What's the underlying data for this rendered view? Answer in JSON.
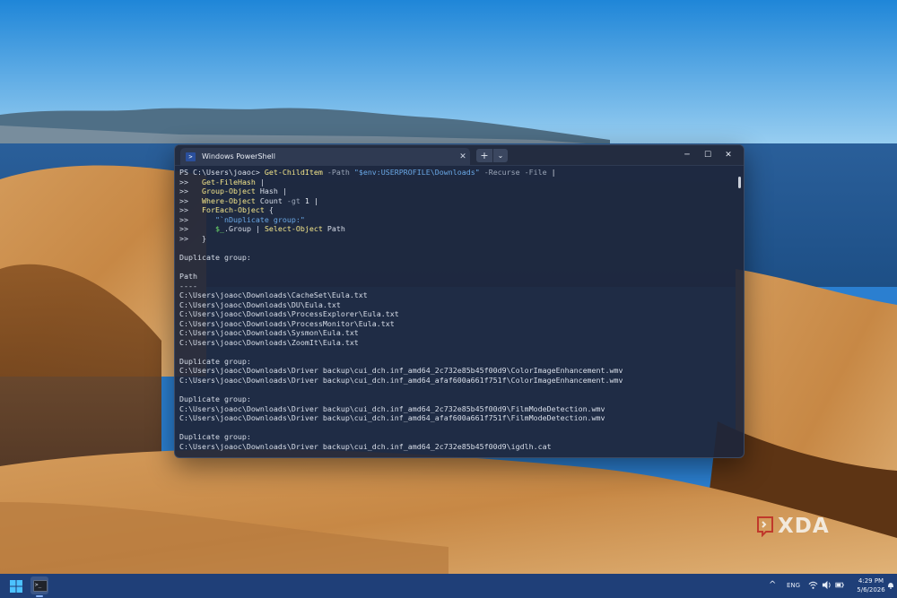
{
  "terminal": {
    "tab_title": "Windows PowerShell",
    "close_tab_glyph": "✕",
    "new_tab_glyph": "+",
    "dropdown_glyph": "⌄",
    "window_minimize": "─",
    "window_maximize": "☐",
    "window_close": "✕",
    "tab_icon": "powershell-icon",
    "lines": [
      [
        {
          "t": "PS C:\\Users\\joaoc> "
        },
        {
          "t": "Get-ChildItem",
          "c": "c-cmd"
        },
        {
          "t": " -Path ",
          "c": "c-param"
        },
        {
          "t": "\"$env:USERPROFILE",
          "c": "c-str2"
        },
        {
          "t": "\\Downloads\"",
          "c": "c-str2"
        },
        {
          "t": " -Recurse -File ",
          "c": "c-param"
        },
        {
          "t": "|"
        }
      ],
      [
        {
          "t": ">>   "
        },
        {
          "t": "Get-FileHash",
          "c": "c-cmd"
        },
        {
          "t": " |"
        }
      ],
      [
        {
          "t": ">>   "
        },
        {
          "t": "Group-Object",
          "c": "c-cmd"
        },
        {
          "t": " Hash |"
        }
      ],
      [
        {
          "t": ">>   "
        },
        {
          "t": "Where-Object",
          "c": "c-cmd"
        },
        {
          "t": " Count "
        },
        {
          "t": "-gt",
          "c": "c-param"
        },
        {
          "t": " 1 |",
          "c": "c-white"
        }
      ],
      [
        {
          "t": ">>   "
        },
        {
          "t": "ForEach-Object",
          "c": "c-cmd"
        },
        {
          "t": " {"
        }
      ],
      [
        {
          "t": ">>      "
        },
        {
          "t": "\"`nDuplicate group:\"",
          "c": "c-str2"
        }
      ],
      [
        {
          "t": ">>      "
        },
        {
          "t": "$_",
          "c": "c-var"
        },
        {
          "t": ".Group | "
        },
        {
          "t": "Select-Object",
          "c": "c-cmd"
        },
        {
          "t": " Path"
        }
      ],
      [
        {
          "t": ">>   }"
        }
      ],
      [
        {
          "t": ""
        }
      ],
      [
        {
          "t": "Duplicate group:"
        }
      ],
      [
        {
          "t": ""
        }
      ],
      [
        {
          "t": "Path"
        }
      ],
      [
        {
          "t": "----"
        }
      ],
      [
        {
          "t": "C:\\Users\\joaoc\\Downloads\\CacheSet\\Eula.txt"
        }
      ],
      [
        {
          "t": "C:\\Users\\joaoc\\Downloads\\DU\\Eula.txt"
        }
      ],
      [
        {
          "t": "C:\\Users\\joaoc\\Downloads\\ProcessExplorer\\Eula.txt"
        }
      ],
      [
        {
          "t": "C:\\Users\\joaoc\\Downloads\\ProcessMonitor\\Eula.txt"
        }
      ],
      [
        {
          "t": "C:\\Users\\joaoc\\Downloads\\Sysmon\\Eula.txt"
        }
      ],
      [
        {
          "t": "C:\\Users\\joaoc\\Downloads\\ZoomIt\\Eula.txt"
        }
      ],
      [
        {
          "t": ""
        }
      ],
      [
        {
          "t": "Duplicate group:"
        }
      ],
      [
        {
          "t": "C:\\Users\\joaoc\\Downloads\\Driver backup\\cui_dch.inf_amd64_2c732e85b45f00d9\\ColorImageEnhancement.wmv"
        }
      ],
      [
        {
          "t": "C:\\Users\\joaoc\\Downloads\\Driver backup\\cui_dch.inf_amd64_afaf600a661f751f\\ColorImageEnhancement.wmv"
        }
      ],
      [
        {
          "t": ""
        }
      ],
      [
        {
          "t": "Duplicate group:"
        }
      ],
      [
        {
          "t": "C:\\Users\\joaoc\\Downloads\\Driver backup\\cui_dch.inf_amd64_2c732e85b45f00d9\\FilmModeDetection.wmv"
        }
      ],
      [
        {
          "t": "C:\\Users\\joaoc\\Downloads\\Driver backup\\cui_dch.inf_amd64_afaf600a661f751f\\FilmModeDetection.wmv"
        }
      ],
      [
        {
          "t": ""
        }
      ],
      [
        {
          "t": "Duplicate group:"
        }
      ],
      [
        {
          "t": "C:\\Users\\joaoc\\Downloads\\Driver backup\\cui_dch.inf_amd64_2c732e85b45f00d9\\igdlh.cat"
        }
      ]
    ]
  },
  "watermark": {
    "text": "XDA"
  },
  "taskbar": {
    "start_icon": "windows-start-icon",
    "pinned_app": "terminal-app-icon",
    "tray_chevron": "^",
    "language": "ENG",
    "tray_icons": [
      "wifi-icon",
      "volume-icon",
      "battery-icon"
    ],
    "time": "4:29 PM",
    "date": "5/6/2026",
    "notification_icon": "bell-icon"
  },
  "colors": {
    "terminal_bg": "#1e263a",
    "command": "#f3e58a",
    "parameter": "#9aa5b7",
    "string": "#6aa8e6",
    "variable": "#6ede6c",
    "taskbar": "#1f3f78"
  }
}
